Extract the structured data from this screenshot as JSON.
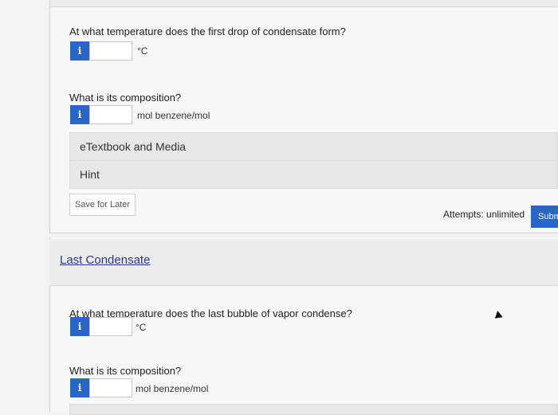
{
  "part1": {
    "q1": {
      "question": "At what temperature does the first drop of condensate form?",
      "unit": "°C",
      "value": ""
    },
    "q2": {
      "question": "What is its composition?",
      "unit": "mol benzene/mol",
      "value": ""
    }
  },
  "info_glyph": "i",
  "etextbook_label": "eTextbook and Media",
  "hint_label": "Hint",
  "save_label": "Save for Later",
  "attempts_text": "Attempts: unlimited",
  "submit_label": "Subm",
  "part2": {
    "title": "Last Condensate",
    "q1": {
      "question": "At what temperature does the last bubble of vapor condense?",
      "unit": "°C",
      "value": ""
    },
    "q2": {
      "question": "What is its composition?",
      "unit": "mol benzene/mol",
      "value": ""
    }
  },
  "colors": {
    "accent": "#2a66c8",
    "link": "#2a3b7a"
  }
}
